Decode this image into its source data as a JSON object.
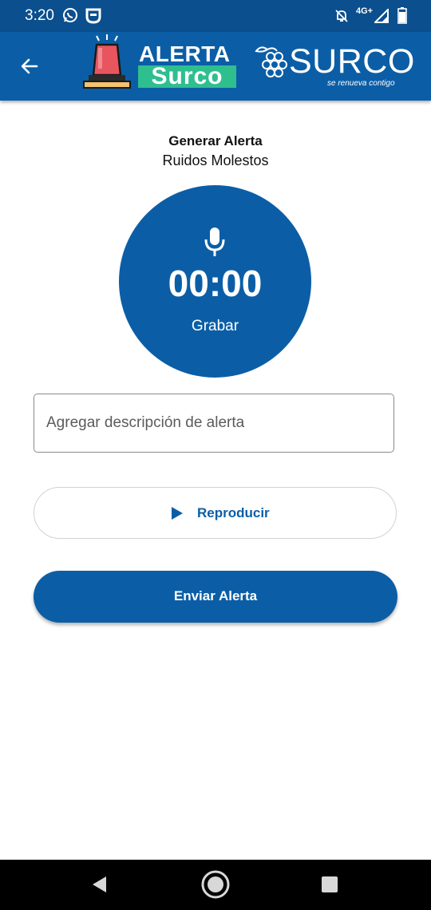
{
  "status_bar": {
    "time": "3:20",
    "network": "4G+",
    "icons": [
      "whatsapp-icon",
      "app-notification-icon",
      "notifications-muted-icon",
      "signal-icon",
      "battery-icon"
    ]
  },
  "app_bar": {
    "logo_alerta": "ALERTA",
    "logo_surco": "Surco",
    "brand_name": "SURCO",
    "brand_tagline": "se renueva contigo",
    "colors": {
      "bar": "#0b5ea6",
      "accent_green": "#2fbf8f"
    }
  },
  "page": {
    "title": "Generar Alerta",
    "subtitle": "Ruidos Molestos"
  },
  "recorder": {
    "timer": "00:00",
    "label": "Grabar",
    "icon": "microphone-icon"
  },
  "description": {
    "placeholder": "Agregar descripción de alerta",
    "value": ""
  },
  "playback": {
    "label": "Reproducir",
    "icon": "play-icon"
  },
  "submit": {
    "label": "Enviar Alerta"
  },
  "colors": {
    "primary": "#0b5ea6",
    "status_bar": "#0b4f8e"
  }
}
